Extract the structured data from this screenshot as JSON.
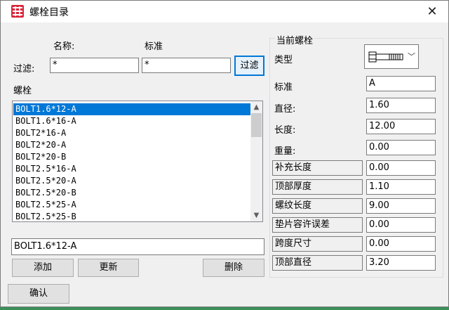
{
  "window": {
    "title": "螺栓目录",
    "icon": "app-grid-icon",
    "close_icon": "close-icon",
    "close_glyph": "✕"
  },
  "filter": {
    "label": "过滤:",
    "name_header": "名称:",
    "standard_header": "标准",
    "name_value": "*",
    "standard_value": "*",
    "button": "过滤"
  },
  "bolt_list": {
    "label": "螺栓",
    "items": [
      "BOLT1.6*12-A",
      "BOLT1.6*16-A",
      "BOLT2*16-A",
      "BOLT2*20-A",
      "BOLT2*20-B",
      "BOLT2.5*16-A",
      "BOLT2.5*20-A",
      "BOLT2.5*20-B",
      "BOLT2.5*25-A",
      "BOLT2.5*25-B"
    ],
    "selected_index": 0
  },
  "name_edit": {
    "value": "BOLT1.6*12-A"
  },
  "buttons": {
    "add": "添加",
    "update": "更新",
    "delete": "删除",
    "confirm": "确认"
  },
  "current_bolt": {
    "title": "当前螺栓",
    "type_label": "类型",
    "type_icon": "bolt-icon",
    "properties": [
      {
        "label": "标准",
        "value": "A"
      },
      {
        "label": "直径:",
        "value": "1.60"
      },
      {
        "label": "长度:",
        "value": "12.00"
      },
      {
        "label": "重量:",
        "value": "0.00"
      },
      {
        "label": "补充长度",
        "value": "0.00"
      },
      {
        "label": "顶部厚度",
        "value": "1.10"
      },
      {
        "label": "螺纹长度",
        "value": "9.00"
      },
      {
        "label": "垫片容许误差",
        "value": "0.00"
      },
      {
        "label": "跨度尺寸",
        "value": "0.00"
      },
      {
        "label": "顶部直径",
        "value": "3.20"
      }
    ]
  },
  "colors": {
    "selection": "#0078d7",
    "dialog_bg": "#f0f0f0",
    "desktop": "#3d8f5a"
  }
}
